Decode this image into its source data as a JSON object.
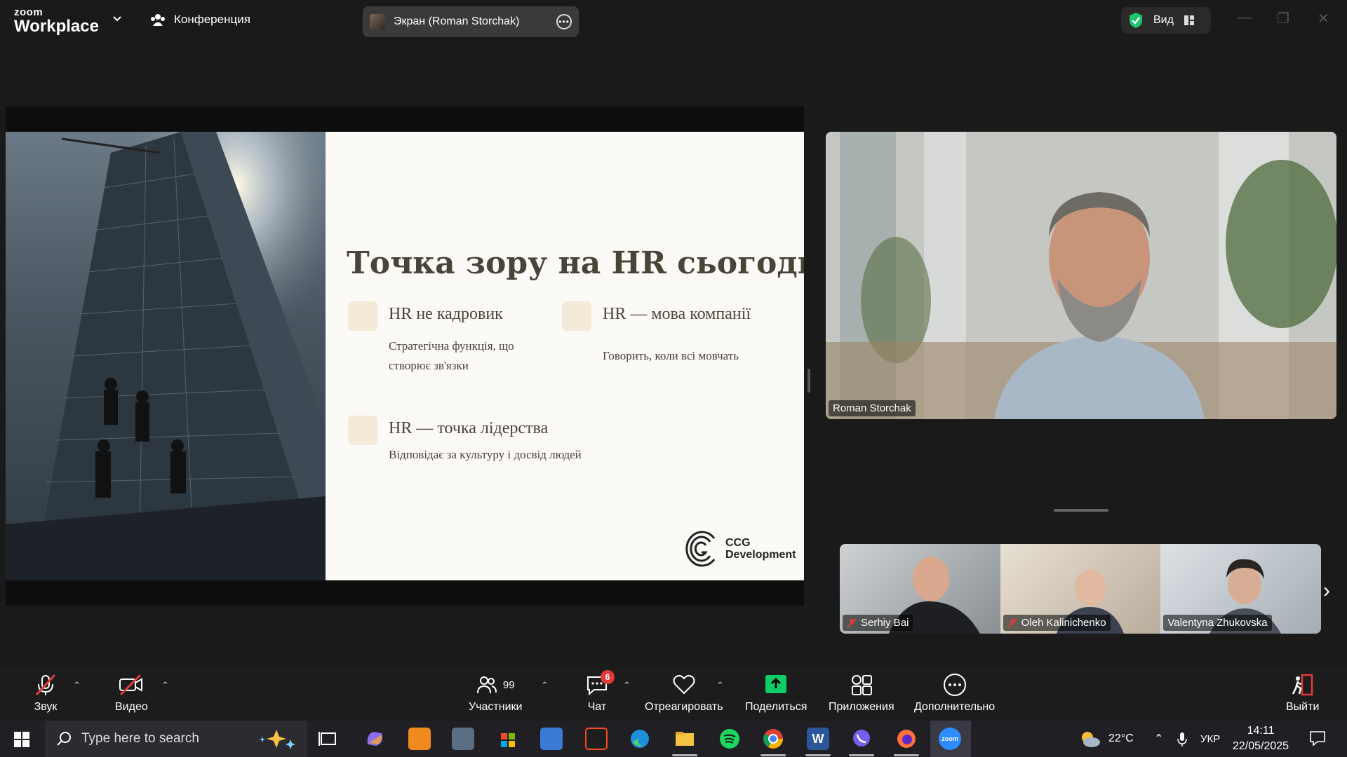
{
  "app": {
    "logo_small": "zoom",
    "logo_big": "Workplace"
  },
  "titlebar": {
    "meeting_label": "Конференция",
    "screen_label": "Экран (Roman Storchak)",
    "view_label": "Вид"
  },
  "slide": {
    "title": "Точка зору на HR сьогодні",
    "cards": [
      {
        "heading": "HR не кадровик",
        "text": "Стратегічна функція, що створює зв'язки"
      },
      {
        "heading": "HR — мова компанії",
        "text": "Говорить, коли всі мовчать"
      },
      {
        "heading": "HR — точка лідерства",
        "text": "Відповідає за культуру і досвід людей"
      }
    ],
    "brand_line1": "CCG",
    "brand_line2": "Development"
  },
  "speaker": {
    "name": "Roman Storchak"
  },
  "participants": [
    {
      "name": "Serhiy Bai",
      "muted": true
    },
    {
      "name": "Oleh Kalinichenko",
      "muted": true
    },
    {
      "name": "Valentyna Zhukovska",
      "muted": false
    }
  ],
  "toolbar": {
    "audio_label": "Звук",
    "video_label": "Видео",
    "participants_label": "Участники",
    "participants_count": "99",
    "chat_label": "Чат",
    "chat_badge": "6",
    "react_label": "Отреагировать",
    "share_label": "Поделиться",
    "apps_label": "Приложения",
    "more_label": "Дополнительно",
    "leave_label": "Выйти"
  },
  "taskbar": {
    "search_placeholder": "Type here to search",
    "weather": "22°C",
    "language": "УКР",
    "time": "14:11",
    "date": "22/05/2025"
  },
  "colors": {
    "share_green": "#0fce6a",
    "badge_red": "#e23b3b",
    "shield_green": "#1ec46a"
  }
}
